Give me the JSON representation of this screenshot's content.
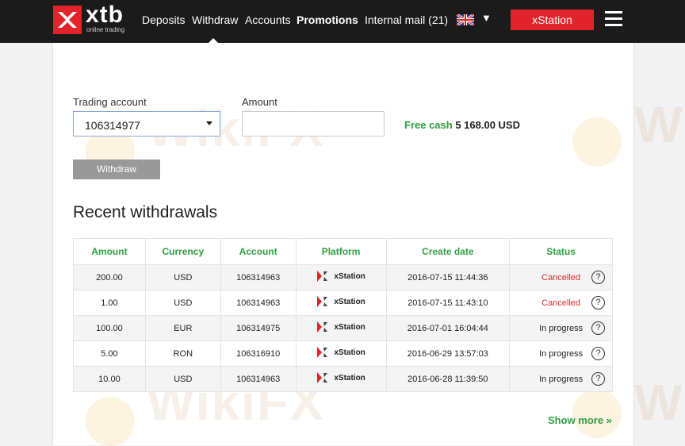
{
  "brand": {
    "name": "xtb",
    "tagline": "online trading"
  },
  "nav": {
    "deposits": "Deposits",
    "withdraw": "Withdraw",
    "accounts": "Accounts",
    "promotions": "Promotions",
    "internal_mail": "Internal mail",
    "mail_count": "(21)",
    "language_caret": "▼",
    "xstation_button": "xStation"
  },
  "form": {
    "trading_account_label": "Trading account",
    "trading_account_value": "106314977",
    "amount_label": "Amount",
    "amount_value": "",
    "free_cash_label": "Free cash",
    "free_cash_value": "5 168.00 USD",
    "withdraw_button": "Withdraw"
  },
  "withdrawals": {
    "title": "Recent withdrawals",
    "columns": [
      "Amount",
      "Currency",
      "Account",
      "Platform",
      "Create date",
      "Status"
    ],
    "rows": [
      {
        "amount": "200.00",
        "currency": "USD",
        "account": "106314963",
        "platform": "xStation",
        "date": "2016-07-15 11:44:36",
        "status": "Cancelled"
      },
      {
        "amount": "1.00",
        "currency": "USD",
        "account": "106314963",
        "platform": "xStation",
        "date": "2016-07-15 11:43:10",
        "status": "Cancelled"
      },
      {
        "amount": "100.00",
        "currency": "EUR",
        "account": "106314975",
        "platform": "xStation",
        "date": "2016-07-01 16:04:44",
        "status": "In progress"
      },
      {
        "amount": "5.00",
        "currency": "RON",
        "account": "106316910",
        "platform": "xStation",
        "date": "2016-06-29 13:57:03",
        "status": "In progress"
      },
      {
        "amount": "10.00",
        "currency": "USD",
        "account": "106314963",
        "platform": "xStation",
        "date": "2016-06-28 11:39:50",
        "status": "In progress"
      }
    ],
    "help_glyph": "?",
    "show_more": "Show more »"
  },
  "watermark": "WikiFX",
  "colors": {
    "brand_red": "#e3232c",
    "accent_green": "#2e9f41",
    "cancelled_red": "#d92a2a",
    "topbar": "#1b1b1b"
  }
}
